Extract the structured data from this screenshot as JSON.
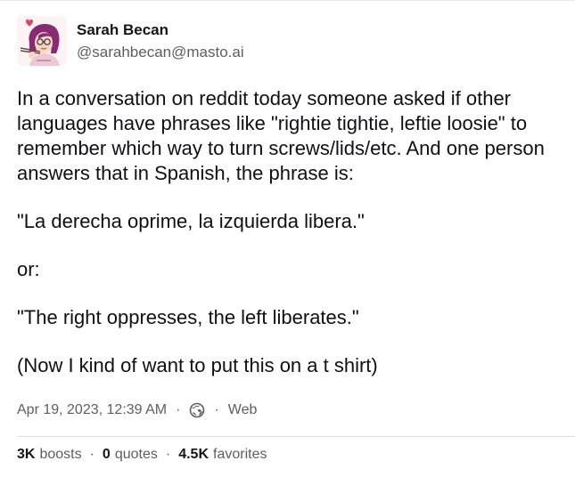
{
  "author": {
    "display_name": "Sarah Becan",
    "handle": "@sarahbecan@masto.ai",
    "avatar_icon": "illustrated-avatar"
  },
  "post": {
    "paragraphs": [
      "In a conversation on reddit today someone asked if other languages have phrases like \"rightie tightie, leftie loosie\" to remember which way to turn screws/lids/etc. And one person answers that in Spanish, the phrase is:",
      "\"La derecha oprime, la izquierda libera.\"",
      "or:",
      "\"The right oppresses, the left liberates.\"",
      "(Now I kind of want to put this on a t shirt)"
    ]
  },
  "meta": {
    "timestamp": "Apr 19, 2023, 12:39 AM",
    "separator": "·",
    "visibility_icon": "globe-icon",
    "client": "Web"
  },
  "stats": {
    "boosts_count": "3K",
    "boosts_label": "boosts",
    "quotes_count": "0",
    "quotes_label": "quotes",
    "favorites_count": "4.5K",
    "favorites_label": "favorites",
    "separator": "·"
  },
  "colors": {
    "text": "#0f0f14",
    "muted": "#5d5d66",
    "divider": "#dcdce2"
  }
}
